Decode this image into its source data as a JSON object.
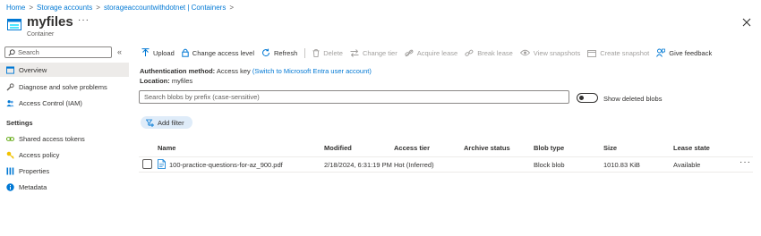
{
  "breadcrumb": {
    "items": [
      "Home",
      "Storage accounts",
      "storageaccountwithdotnet | Containers"
    ]
  },
  "header": {
    "title": "myfiles",
    "subtitle": "Container",
    "more_label": "···"
  },
  "sidebar": {
    "search_placeholder": "Search",
    "collapse_glyph": "«",
    "items": [
      {
        "label": "Overview",
        "icon": "overview-icon",
        "active": true
      },
      {
        "label": "Diagnose and solve problems",
        "icon": "wrench-icon"
      },
      {
        "label": "Access Control (IAM)",
        "icon": "people-icon"
      }
    ],
    "settings_header": "Settings",
    "settings_items": [
      {
        "label": "Shared access tokens",
        "icon": "link-icon"
      },
      {
        "label": "Access policy",
        "icon": "key-icon"
      },
      {
        "label": "Properties",
        "icon": "properties-icon"
      },
      {
        "label": "Metadata",
        "icon": "info-icon"
      }
    ]
  },
  "toolbar": {
    "upload": "Upload",
    "change_access_level": "Change access level",
    "refresh": "Refresh",
    "delete": "Delete",
    "change_tier": "Change tier",
    "acquire_lease": "Acquire lease",
    "break_lease": "Break lease",
    "view_snapshots": "View snapshots",
    "create_snapshot": "Create snapshot",
    "give_feedback": "Give feedback"
  },
  "info": {
    "auth_label": "Authentication method:",
    "auth_value": "Access key",
    "auth_link": "(Switch to Microsoft Entra user account)",
    "location_label": "Location:",
    "location_value": "myfiles"
  },
  "blob_search": {
    "placeholder": "Search blobs by prefix (case-sensitive)"
  },
  "show_deleted": {
    "label": "Show deleted blobs",
    "enabled": false
  },
  "add_filter": "Add filter",
  "table": {
    "columns": [
      "Name",
      "Modified",
      "Access tier",
      "Archive status",
      "Blob type",
      "Size",
      "Lease state"
    ],
    "rows": [
      {
        "name": "100-practice-questions-for-az_900.pdf",
        "modified": "2/18/2024, 6:31:19 PM",
        "access_tier": "Hot (Inferred)",
        "archive_status": "",
        "blob_type": "Block blob",
        "size": "1010.83 KiB",
        "lease_state": "Available",
        "more": "···"
      }
    ]
  },
  "colors": {
    "accent": "#0078d4",
    "disabled": "#a19f9d",
    "filter_pill": "#dfecf9",
    "active_nav": "#edebe9"
  }
}
